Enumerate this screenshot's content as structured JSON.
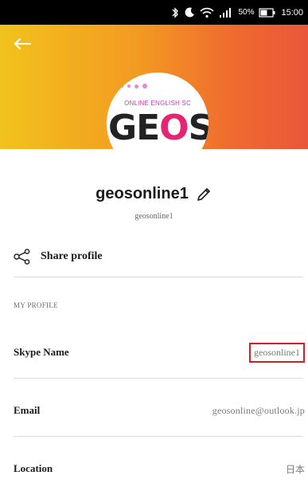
{
  "status_bar": {
    "battery": "50%",
    "time": "15:00",
    "icons": [
      "bluetooth-icon",
      "moon-icon",
      "wifi-icon",
      "signal-icon",
      "battery-icon"
    ]
  },
  "header": {
    "gradient_colors": [
      "#f2c21c",
      "#f39a22",
      "#ef6b2f",
      "#e9563a"
    ],
    "back_icon": "back-arrow-icon",
    "avatar": {
      "logo_line": "ONLINE ENGLISH SC",
      "logo_big": "GEOS",
      "accent_color": "#e5256f"
    }
  },
  "profile": {
    "display_name": "geosonline1",
    "username": "geosonline1",
    "edit_icon": "pencil-icon"
  },
  "share": {
    "label": "Share profile",
    "icon": "share-icon"
  },
  "my_profile": {
    "section_title": "MY PROFILE",
    "fields": [
      {
        "label": "Skype Name",
        "value": "geosonline1"
      },
      {
        "label": "Email",
        "value": "geosonline@outlook.jp"
      },
      {
        "label": "Location",
        "value": "日本"
      }
    ]
  },
  "colors": {
    "highlight_border": "#d0202a"
  }
}
